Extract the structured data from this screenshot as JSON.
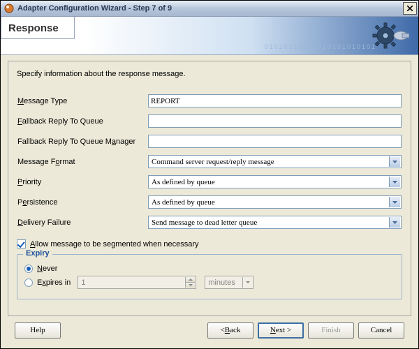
{
  "window": {
    "title": "Adapter Configuration Wizard - Step 7 of 9"
  },
  "banner": {
    "heading": "Response"
  },
  "description": "Specify information about the response message.",
  "form": {
    "messageType": {
      "label": "Message Type",
      "value": "REPORT"
    },
    "fallbackQueue": {
      "label": "Fallback Reply To Queue",
      "value": ""
    },
    "fallbackQM": {
      "label": "Fallback Reply To Queue Manager",
      "value": ""
    },
    "messageFormat": {
      "label": "Message Format",
      "value": "Command server request/reply message"
    },
    "priority": {
      "label": "Priority",
      "value": "As defined by queue"
    },
    "persistence": {
      "label": "Persistence",
      "value": "As defined by queue"
    },
    "deliveryFailure": {
      "label": "Delivery Failure",
      "value": "Send message to dead letter queue"
    }
  },
  "segmentCheckbox": {
    "label": "Allow message to be segmented when necessary",
    "checked": true
  },
  "expiry": {
    "legend": "Expiry",
    "neverLabel": "Never",
    "expiresLabel": "Expires in",
    "selected": "never",
    "amount": "1",
    "unit": "minutes"
  },
  "buttons": {
    "help": "Help",
    "back": "< Back",
    "next": "Next >",
    "finish": "Finish",
    "cancel": "Cancel"
  }
}
